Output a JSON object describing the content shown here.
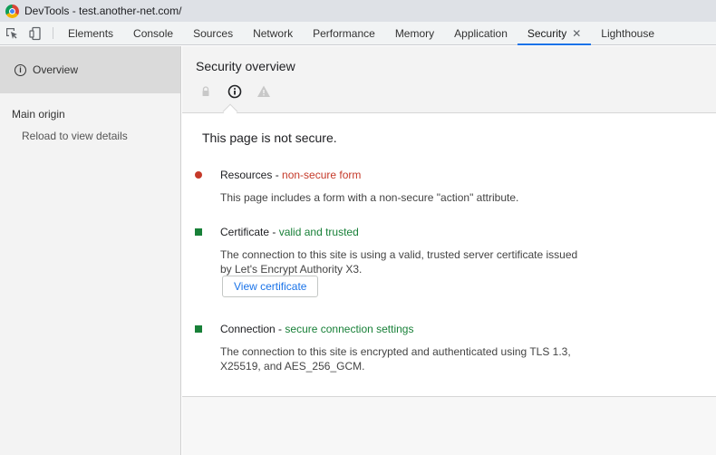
{
  "window": {
    "title": "DevTools - test.another-net.com/"
  },
  "toolbar": {
    "inspect_icon": "inspect-element-icon",
    "device_icon": "device-toolbar-icon"
  },
  "tabs": [
    {
      "label": "Elements"
    },
    {
      "label": "Console"
    },
    {
      "label": "Sources"
    },
    {
      "label": "Network"
    },
    {
      "label": "Performance"
    },
    {
      "label": "Memory"
    },
    {
      "label": "Application"
    },
    {
      "label": "Security",
      "active": true,
      "close": "✕"
    },
    {
      "label": "Lighthouse"
    }
  ],
  "sidebar": {
    "overview_label": "Overview",
    "main_origin_label": "Main origin",
    "reload_label": "Reload to view details"
  },
  "main": {
    "title": "Security overview",
    "summary": "This page is not secure.",
    "items": [
      {
        "name": "Resources",
        "separator": " - ",
        "status": "non-secure form",
        "status_color": "#c53929",
        "description": "This page includes a form with a non-secure \"action\" attribute."
      },
      {
        "name": "Certificate",
        "separator": " - ",
        "status": "valid and trusted",
        "status_color": "#188038",
        "description": "The connection to this site is using a valid, trusted server certificate issued by Let's Encrypt Authority X3.",
        "button": "View certificate"
      },
      {
        "name": "Connection",
        "separator": " - ",
        "status": "secure connection settings",
        "status_color": "#188038",
        "description": "The connection to this site is encrypted and authenticated using TLS 1.3, X25519, and AES_256_GCM."
      }
    ]
  },
  "colors": {
    "accent": "#1a73e8",
    "insecure": "#c53929",
    "secure": "#188038"
  }
}
